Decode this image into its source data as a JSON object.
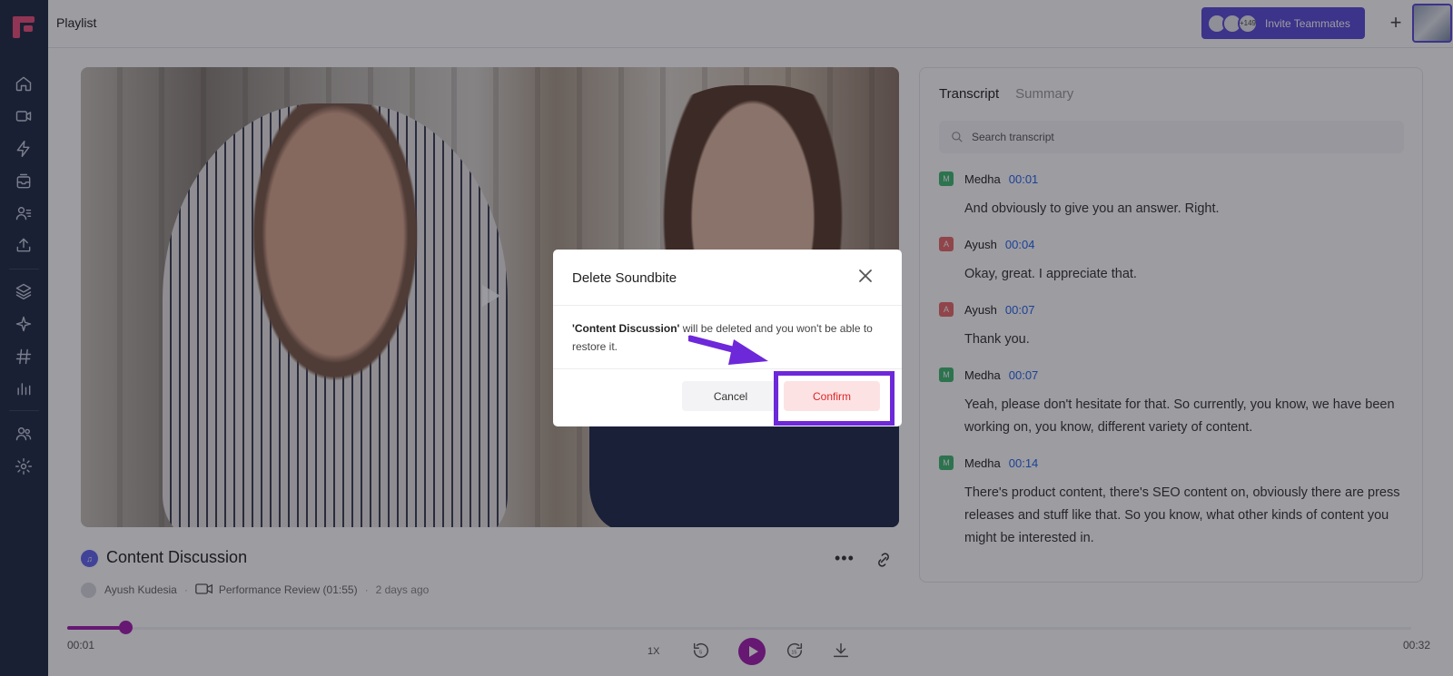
{
  "app": {
    "page_title": "Playlist"
  },
  "header": {
    "avatar_count": "+149",
    "invite_label": "Invite Teammates",
    "plus_label": "+"
  },
  "sidebar": {
    "items": [
      "home-icon",
      "video-icon",
      "bolt-icon",
      "inbox-icon",
      "contacts-icon",
      "upload-icon",
      "layers-icon",
      "sparkle-icon",
      "hashtag-icon",
      "analytics-icon",
      "team-icon",
      "settings-icon"
    ]
  },
  "clip": {
    "title": "Content Discussion",
    "author": "Ayush Kudesia",
    "source": "Performance Review (01:55)",
    "age": "2 days ago"
  },
  "transcript": {
    "tabs": [
      "Transcript",
      "Summary"
    ],
    "search_placeholder": "Search transcript",
    "entries": [
      {
        "initial": "M",
        "speaker": "Medha",
        "time": "00:01",
        "text": "And obviously to give you an answer. Right."
      },
      {
        "initial": "A",
        "speaker": "Ayush",
        "time": "00:04",
        "text": "Okay, great. I appreciate that."
      },
      {
        "initial": "A",
        "speaker": "Ayush",
        "time": "00:07",
        "text": "Thank you."
      },
      {
        "initial": "M",
        "speaker": "Medha",
        "time": "00:07",
        "text": "Yeah, please don't hesitate for that. So currently, you know, we have been working on, you know, different variety of content."
      },
      {
        "initial": "M",
        "speaker": "Medha",
        "time": "00:14",
        "text": "There's product content, there's SEO content on, obviously there are press releases and stuff like that. So you know, what other kinds of content you might be interested in."
      }
    ],
    "speaker_colors": {
      "M": "#3fb871",
      "A": "#ea6a6a"
    }
  },
  "player": {
    "current_time": "00:01",
    "total_time": "00:32",
    "speed": "1X",
    "progress": 0.043,
    "rewind_label": "5",
    "forward_label": "15"
  },
  "modal": {
    "title": "Delete Soundbite",
    "body_name": "'Content Discussion'",
    "body_rest": " will be deleted and you won't be able to restore it.",
    "cancel_label": "Cancel",
    "confirm_label": "Confirm"
  },
  "colors": {
    "accent": "#a21caf",
    "brand": "#5b4bd8",
    "danger": "#dc2626",
    "sidebar_bg": "#1f2a44"
  }
}
